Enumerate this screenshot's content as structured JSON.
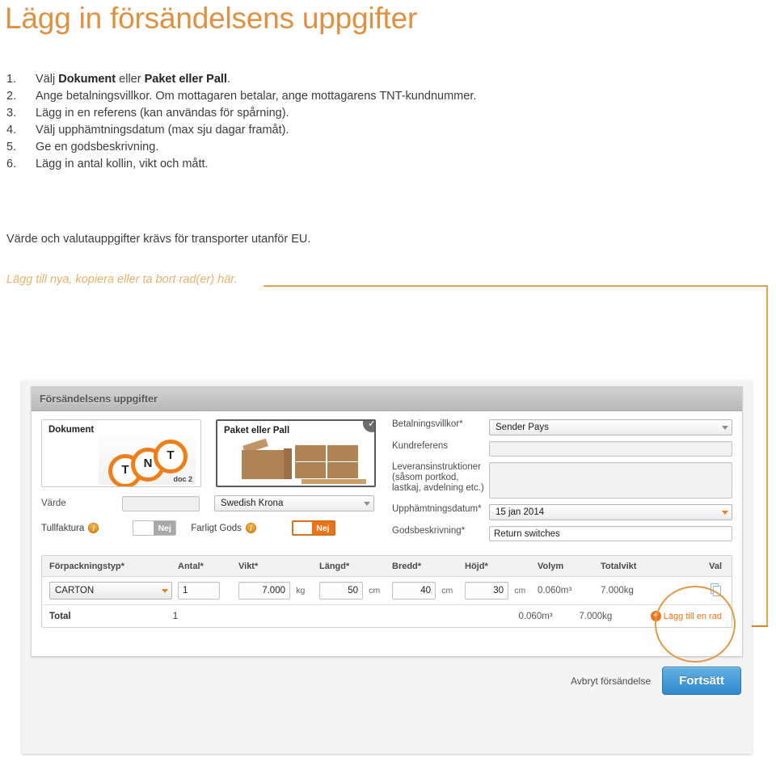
{
  "page": {
    "title": "Lägg in försändelsens uppgifter",
    "accent_color": "#e0913f",
    "note": "Värde och valutauppgifter krävs för transporter utanför EU.",
    "annotation_label": "Lägg till nya, kopiera eller ta bort rad(er) här."
  },
  "steps": [
    {
      "num": "1.",
      "pre": "Välj ",
      "b1": "Dokument",
      "mid": " eller ",
      "b2": "Paket eller Pall",
      "post": "."
    },
    {
      "num": "2.",
      "pre": "Ange betalningsvillkor. Om mottagaren betalar, ange mottagarens TNT-kundnummer.",
      "b1": "",
      "mid": "",
      "b2": "",
      "post": ""
    },
    {
      "num": "3.",
      "pre": "Lägg in en referens (kan användas för spårning).",
      "b1": "",
      "mid": "",
      "b2": "",
      "post": ""
    },
    {
      "num": "4.",
      "pre": "Välj upphämtningsdatum (max sju dagar framåt).",
      "b1": "",
      "mid": "",
      "b2": "",
      "post": ""
    },
    {
      "num": "5.",
      "pre": "Ge en godsbeskrivning.",
      "b1": "",
      "mid": "",
      "b2": "",
      "post": ""
    },
    {
      "num": "6.",
      "pre": "Lägg in antal kollin, vikt och mått.",
      "b1": "",
      "mid": "",
      "b2": "",
      "post": ""
    }
  ],
  "screenshot": {
    "panel_header": "Försändelsens uppgifter",
    "cards": {
      "document": {
        "title": "Dokument",
        "art_letters": [
          "T",
          "N",
          "T"
        ],
        "art_caption": "doc 2",
        "selected": false
      },
      "parcel": {
        "title": "Paket eller Pall",
        "selected": true,
        "check_glyph": "✓"
      }
    },
    "left_fields": {
      "value_label": "Värde",
      "value_text": "",
      "currency_label": "Swedish Krona",
      "customs_label": "Tullfaktura",
      "customs_state": "Nej",
      "dangerous_label": "Farligt Gods",
      "dangerous_state": "Nej",
      "info_glyph": "i"
    },
    "right_fields": [
      {
        "label": "Betalningsvillkor*",
        "value": "Sender Pays",
        "type": "select"
      },
      {
        "label": "Kundreferens",
        "value": "",
        "type": "input"
      },
      {
        "label": "Leveransinstruktioner (såsom portkod, lastkaj, avdelning etc.)",
        "value": "",
        "type": "textarea"
      },
      {
        "label": "Upphämtningsdatum*",
        "value": "15 jan 2014",
        "type": "select"
      },
      {
        "label": "Godsbeskrivning*",
        "value": "Return switches",
        "type": "input"
      }
    ],
    "table": {
      "headers": [
        "Förpackningstyp*",
        "Antal*",
        "Vikt*",
        "Längd*",
        "Bredd*",
        "Höjd*",
        "Volym",
        "Totalvikt",
        "Val"
      ],
      "row": {
        "package_type": "CARTON",
        "quantity": "1",
        "weight": "7.000",
        "weight_unit": "kg",
        "length": "50",
        "length_unit": "cm",
        "width": "40",
        "width_unit": "cm",
        "height": "30",
        "height_unit": "cm",
        "volume": "0.060m³",
        "total_weight": "7.000kg"
      },
      "total": {
        "label": "Total",
        "quantity": "1",
        "volume": "0.060m³",
        "total_weight": "7.000kg",
        "add_row_label": "Lägg till en rad",
        "add_row_glyph": "+"
      }
    },
    "footer": {
      "cancel_label": "Avbryt försändelse",
      "continue_label": "Fortsätt",
      "continue_color": "#3f94d4"
    }
  }
}
